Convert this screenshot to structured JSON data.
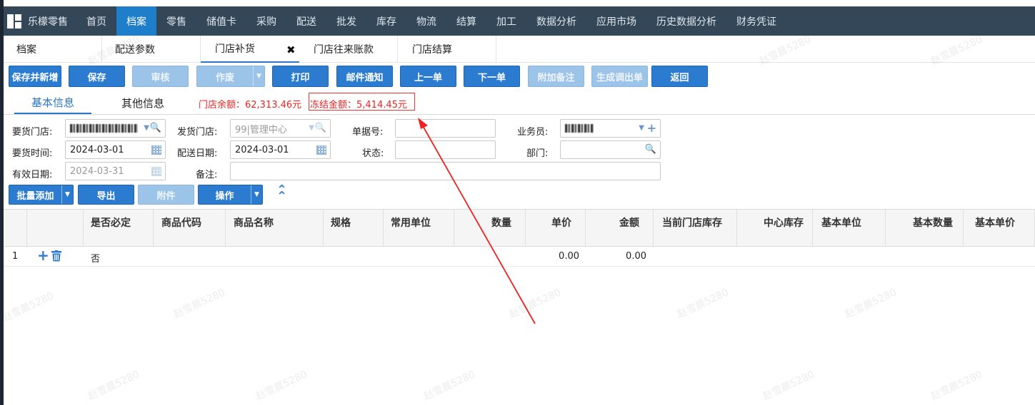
{
  "nav": {
    "brand": "乐檬零售",
    "items": [
      "首页",
      "档案",
      "零售",
      "储值卡",
      "采购",
      "配送",
      "批发",
      "库存",
      "物流",
      "结算",
      "加工",
      "数据分析",
      "应用市场",
      "历史数据分析",
      "财务凭证"
    ]
  },
  "tabs": [
    "档案",
    "配送参数",
    "门店补货",
    "门店往来账款",
    "门店结算"
  ],
  "toolbar": [
    "保存并新增",
    "保存",
    "审核",
    "作废",
    "打印",
    "邮件通知",
    "上一单",
    "下一单",
    "附加备注",
    "生成调出单",
    "返回"
  ],
  "subtabs": [
    "基本信息",
    "其他信息"
  ],
  "balance": {
    "store": "门店余额：62,313.46元",
    "frozen": "冻结金额：5,414.45元"
  },
  "form": {
    "req_store_label": "要货门店:",
    "send_store_label": "发货门店:",
    "send_store_value": "99|管理中心",
    "doc_no_label": "单据号:",
    "staff_label": "业务员:",
    "req_time_label": "要货时间:",
    "req_time_value": "2024-03-01",
    "ship_date_label": "配送日期:",
    "ship_date_value": "2024-03-01",
    "status_label": "状态:",
    "dept_label": "部门:",
    "valid_label": "有效日期:",
    "valid_value": "2024-03-31",
    "remark_label": "备注:"
  },
  "actions": [
    "批量添加",
    "导出",
    "附件",
    "操作"
  ],
  "grid": {
    "headers": [
      "是否必定",
      "商品代码",
      "商品名称",
      "规格",
      "常用单位",
      "数量",
      "单价",
      "金额",
      "当前门店库存",
      "中心库存",
      "基本单位",
      "基本数量",
      "基本单价"
    ],
    "rows": [
      {
        "no": "1",
        "required": "否",
        "price": "0.00",
        "amount": "0.00"
      }
    ]
  },
  "watermark": "赵雪晨5280",
  "colors": {
    "nav": "#344759",
    "accent": "#2b7cd0",
    "alert": "#e22222"
  }
}
